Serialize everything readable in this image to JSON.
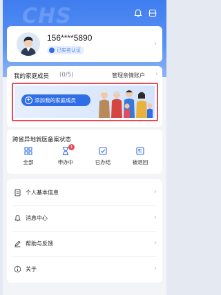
{
  "header": {
    "watermark_text": "CHS",
    "bell_icon": "bell-icon",
    "scan_icon": "scan-icon"
  },
  "profile": {
    "phone": "156****5890",
    "verify_label": "已实名认证",
    "avatar_icon": "user-avatar"
  },
  "family": {
    "title": "我的家庭成员",
    "count": "(0/5)",
    "manage_label": "管理亲情账户",
    "add_button": "添加我的家庭成员",
    "banner_colors": {
      "accent": "#2f6ee6",
      "highlight": "#e84b55"
    }
  },
  "filing": {
    "title": "跨省异地就医备案状态",
    "tabs": [
      {
        "label": "全部",
        "icon": "grid-icon"
      },
      {
        "label": "申办中",
        "icon": "hourglass-icon",
        "badge": "1"
      },
      {
        "label": "已办结",
        "icon": "check-icon"
      },
      {
        "label": "被退回",
        "icon": "return-icon"
      }
    ]
  },
  "menu": {
    "items": [
      {
        "label": "个人基本信息",
        "icon": "document-icon"
      },
      {
        "label": "消息中心",
        "icon": "bell-icon"
      },
      {
        "label": "帮助与反馈",
        "icon": "pen-icon"
      },
      {
        "label": "关于",
        "icon": "info-icon"
      }
    ]
  }
}
